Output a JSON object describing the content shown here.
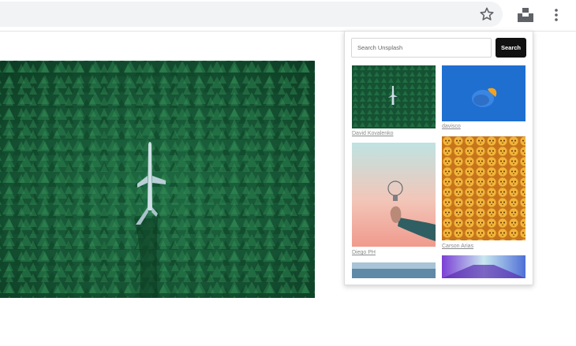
{
  "browser": {
    "icons": {
      "bookmark": "star-icon",
      "extension": "unsplash-extension-icon",
      "menu": "vertical-dots-icon"
    }
  },
  "main": {
    "image_subject": "forest-with-airplane-photo"
  },
  "popup": {
    "search": {
      "placeholder": "Search Unsplash",
      "value": ""
    },
    "search_button_label": "Search",
    "photos": [
      {
        "credit": "David Kovalenko"
      },
      {
        "credit": "davisco"
      },
      {
        "credit": "Diego PH"
      },
      {
        "credit": "Carson Arias"
      }
    ]
  },
  "colors": {
    "button_bg": "#111111",
    "credit_text": "#8a8a8a",
    "omnibox_bg": "#f1f3f4"
  }
}
